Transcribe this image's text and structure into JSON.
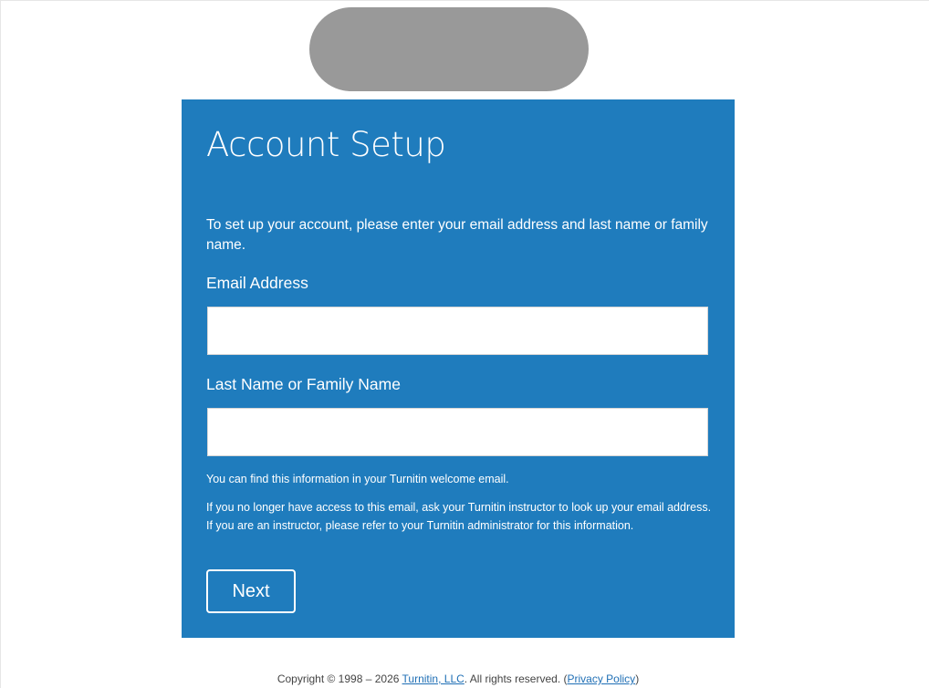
{
  "logo": {
    "color": "#999999"
  },
  "card": {
    "background": "#1f7cbd",
    "title": "Account Setup",
    "intro": "To set up your account, please enter your email address and last name or family name.",
    "email_label": "Email Address",
    "email_value": "",
    "lastname_label": "Last Name or Family Name",
    "lastname_value": "",
    "help_1": "You can find this information in your Turnitin welcome email.",
    "help_2": "If you no longer have access to this email, ask your Turnitin instructor to look up your email address. If you are an instructor, please refer to your Turnitin administrator for this information.",
    "next_label": "Next"
  },
  "footer": {
    "copyright_prefix": "Copyright © 1998 – 2026 ",
    "company_link": "Turnitin, LLC",
    "rights_text": ". All rights reserved. (",
    "privacy_link": "Privacy Policy",
    "close_paren": ")"
  }
}
